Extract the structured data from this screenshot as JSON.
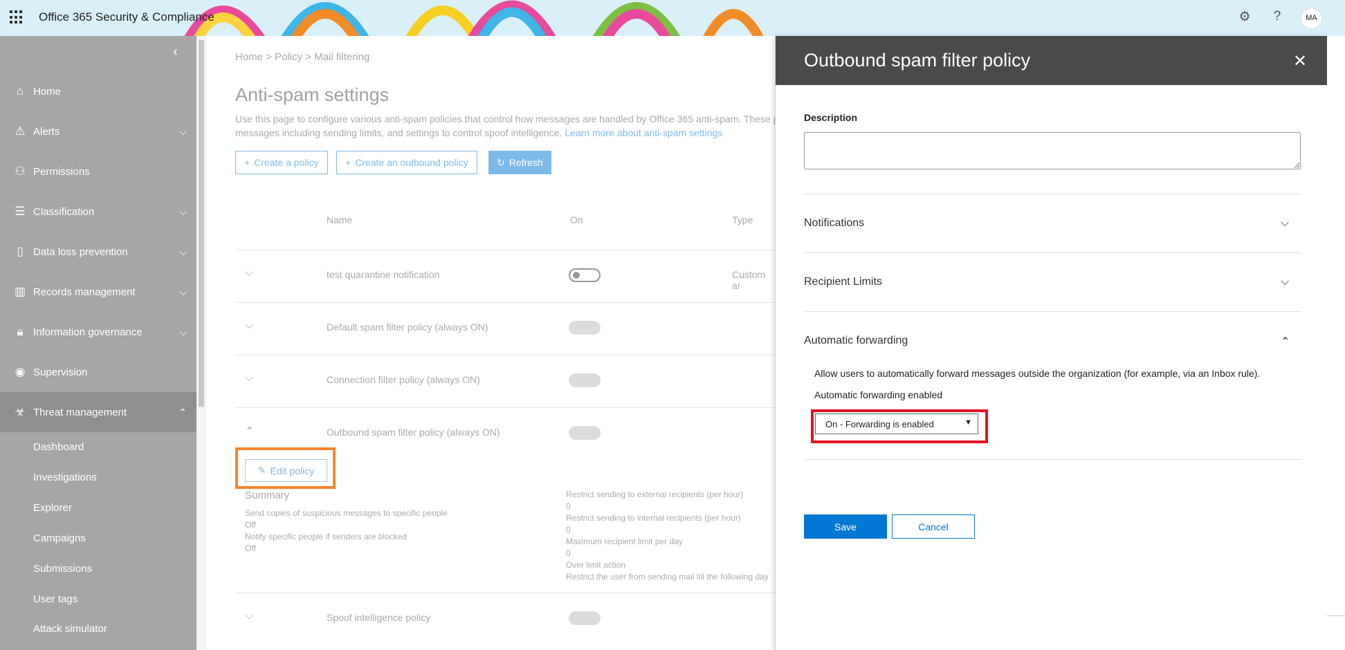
{
  "header": {
    "app_title": "Office 365 Security & Compliance",
    "settings_icon": "gear-icon",
    "help_icon": "question-icon",
    "avatar_initials": "MA"
  },
  "sidebar": {
    "items": [
      {
        "label": "Home",
        "icon": "home-icon"
      },
      {
        "label": "Alerts",
        "icon": "warning-icon"
      },
      {
        "label": "Permissions",
        "icon": "people-icon"
      },
      {
        "label": "Classification",
        "icon": "list-icon"
      },
      {
        "label": "Data loss prevention",
        "icon": "document-lock-icon"
      },
      {
        "label": "Records management",
        "icon": "chart-icon"
      },
      {
        "label": "Information governance",
        "icon": "lock-icon"
      },
      {
        "label": "Supervision",
        "icon": "eye-icon"
      },
      {
        "label": "Threat management",
        "icon": "biohazard-icon"
      }
    ],
    "subitems": [
      "Dashboard",
      "Investigations",
      "Explorer",
      "Campaigns",
      "Submissions",
      "User tags",
      "Attack simulator"
    ]
  },
  "main": {
    "breadcrumb": "Home  >  Policy  >  Mail filtering",
    "title": "Anti-spam settings",
    "description": "Use this page to configure various anti-spam policies that control how messages are handled by Office 365 anti-spam. These p messages including sending limits, and settings to control spoof intelligence.",
    "learn_more": "Learn more about anti-spam settings",
    "buttons": {
      "create_policy": "Create a policy",
      "create_outbound": "Create an outbound policy",
      "refresh": "Refresh"
    },
    "columns": {
      "name": "Name",
      "on": "On",
      "type": "Type"
    },
    "rows": [
      {
        "name": "test quarantine notification",
        "type": "Custom ar"
      },
      {
        "name": "Default spam filter policy (always ON)"
      },
      {
        "name": "Connection filter policy (always ON)"
      },
      {
        "name": "Outbound spam filter policy (always ON)"
      },
      {
        "name": "Spoof intelligence policy"
      }
    ],
    "edit_policy": "Edit policy",
    "summary": {
      "title": "Summary",
      "left": [
        "Send copies of suspicious messages to specific people",
        "Off",
        "Notify specific people if senders are blocked",
        "Off"
      ],
      "right": [
        "Restrict sending to external recipients (per hour)",
        "0",
        "Restrict sending to internal recipients (per hour)",
        "0",
        "Maximum recipient limit per day",
        "0",
        "Over limit action",
        "Restrict the user from sending mail till the following day"
      ]
    }
  },
  "panel": {
    "title": "Outbound spam filter policy",
    "description_label": "Description",
    "description_value": "",
    "sections": {
      "notifications": "Notifications",
      "recipient_limits": "Recipient Limits",
      "automatic_forwarding": "Automatic forwarding"
    },
    "auto_forward_text": "Allow users to automatically forward messages outside the organization (for example, via an Inbox rule).",
    "auto_forward_label": "Automatic forwarding enabled",
    "auto_forward_value": "On - Forwarding is enabled",
    "save": "Save",
    "cancel": "Cancel"
  }
}
